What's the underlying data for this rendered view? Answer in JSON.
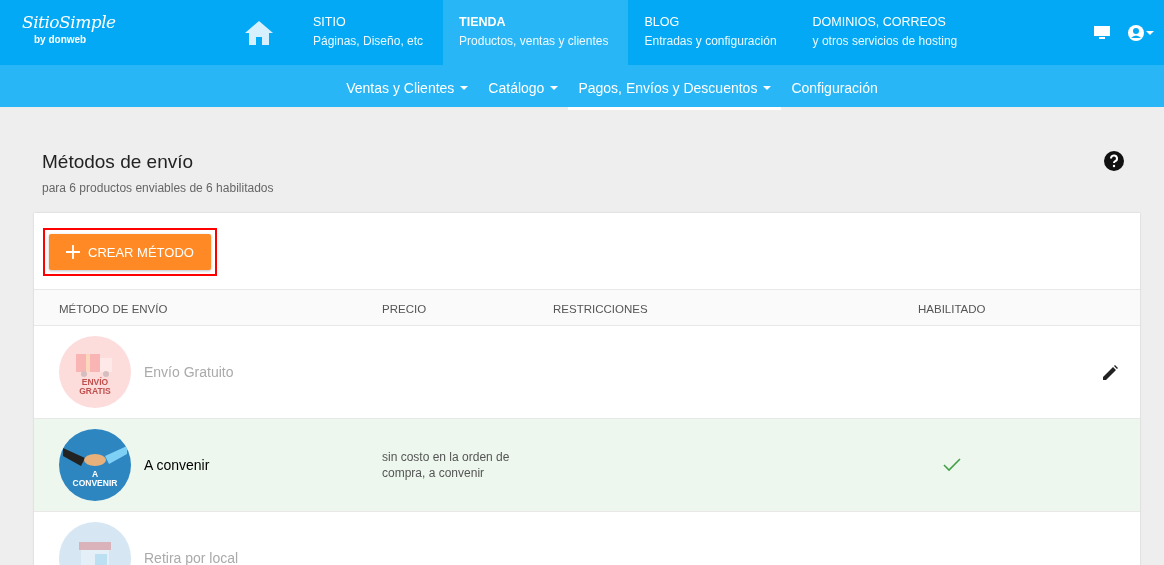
{
  "logo": {
    "name": "SitioSimple",
    "tagline": "by donweb"
  },
  "main_nav": [
    {
      "title": "SITIO",
      "subtitle": "Páginas, Diseño, etc",
      "selected": false
    },
    {
      "title": "TIENDA",
      "subtitle": "Productos, ventas y clientes",
      "selected": true
    },
    {
      "title": "BLOG",
      "subtitle": "Entradas y configuración",
      "selected": false
    },
    {
      "title": "DOMINIOS, CORREOS",
      "subtitle": "y otros servicios de hosting",
      "selected": false
    }
  ],
  "sub_nav": [
    {
      "label": "Ventas y Clientes",
      "dropdown": true,
      "selected": false
    },
    {
      "label": "Catálogo",
      "dropdown": true,
      "selected": false
    },
    {
      "label": "Pagos, Envíos y Descuentos",
      "dropdown": true,
      "selected": true
    },
    {
      "label": "Configuración",
      "dropdown": false,
      "selected": false
    }
  ],
  "page": {
    "title": "Métodos de envío",
    "subtitle": "para 6 productos enviables de 6 habilitados"
  },
  "create_button": {
    "label": "CREAR MÉTODO",
    "highlighted": true
  },
  "table": {
    "columns": [
      "MÉTODO DE ENVÍO",
      "PRECIO",
      "RESTRICCIONES",
      "HABILITADO"
    ],
    "rows": [
      {
        "kind": "gift-truck",
        "badge_text": "ENVÍO GRATIS",
        "name": "Envío Gratuito",
        "price": "",
        "enabled": false,
        "editable": true
      },
      {
        "kind": "handshake",
        "badge_text": "A CONVENIR",
        "name": "A convenir",
        "price": "sin costo en la orden de compra, a convenir",
        "enabled": true,
        "editable": false
      },
      {
        "kind": "store",
        "name": "Retira por local",
        "price": "",
        "enabled": false,
        "editable": false
      }
    ]
  }
}
